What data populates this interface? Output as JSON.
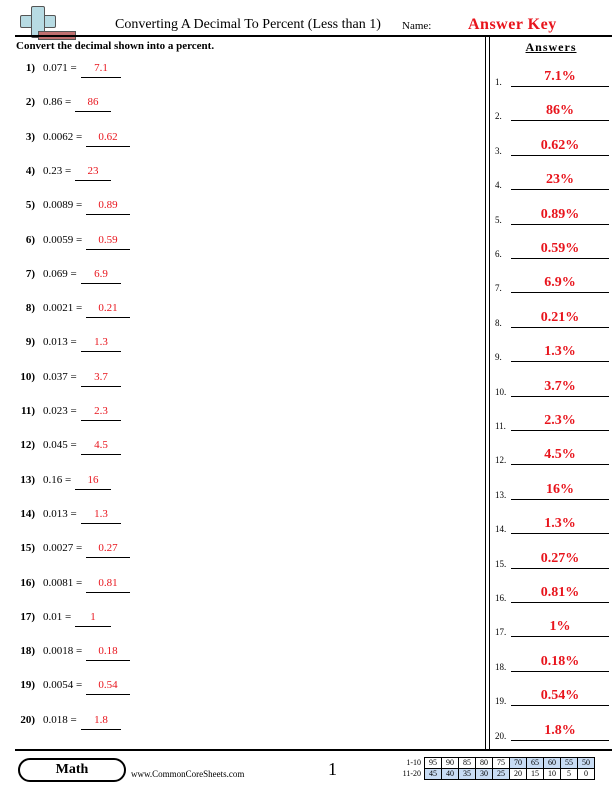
{
  "header": {
    "title": "Converting A Decimal To Percent (Less than 1)",
    "name_label": "Name:",
    "name_value": "Answer Key",
    "logo_icon": "plus-logo-icon"
  },
  "instructions": "Convert the decimal shown into a percent.",
  "answers_heading": "Answers",
  "problems": [
    {
      "num": "1)",
      "question": "0.071 =",
      "answer": "7.1"
    },
    {
      "num": "2)",
      "question": "0.86 =",
      "answer": "86"
    },
    {
      "num": "3)",
      "question": "0.0062 =",
      "answer": "0.62"
    },
    {
      "num": "4)",
      "question": "0.23 =",
      "answer": "23"
    },
    {
      "num": "5)",
      "question": "0.0089 =",
      "answer": "0.89"
    },
    {
      "num": "6)",
      "question": "0.0059 =",
      "answer": "0.59"
    },
    {
      "num": "7)",
      "question": "0.069 =",
      "answer": "6.9"
    },
    {
      "num": "8)",
      "question": "0.0021 =",
      "answer": "0.21"
    },
    {
      "num": "9)",
      "question": "0.013 =",
      "answer": "1.3"
    },
    {
      "num": "10)",
      "question": "0.037 =",
      "answer": "3.7"
    },
    {
      "num": "11)",
      "question": "0.023 =",
      "answer": "2.3"
    },
    {
      "num": "12)",
      "question": "0.045 =",
      "answer": "4.5"
    },
    {
      "num": "13)",
      "question": "0.16 =",
      "answer": "16"
    },
    {
      "num": "14)",
      "question": "0.013 =",
      "answer": "1.3"
    },
    {
      "num": "15)",
      "question": "0.0027 =",
      "answer": "0.27"
    },
    {
      "num": "16)",
      "question": "0.0081 =",
      "answer": "0.81"
    },
    {
      "num": "17)",
      "question": "0.01 =",
      "answer": "1"
    },
    {
      "num": "18)",
      "question": "0.0018 =",
      "answer": "0.18"
    },
    {
      "num": "19)",
      "question": "0.0054 =",
      "answer": "0.54"
    },
    {
      "num": "20)",
      "question": "0.018 =",
      "answer": "1.8"
    }
  ],
  "answer_key": [
    {
      "num": "1.",
      "value": "7.1%"
    },
    {
      "num": "2.",
      "value": "86%"
    },
    {
      "num": "3.",
      "value": "0.62%"
    },
    {
      "num": "4.",
      "value": "23%"
    },
    {
      "num": "5.",
      "value": "0.89%"
    },
    {
      "num": "6.",
      "value": "0.59%"
    },
    {
      "num": "7.",
      "value": "6.9%"
    },
    {
      "num": "8.",
      "value": "0.21%"
    },
    {
      "num": "9.",
      "value": "1.3%"
    },
    {
      "num": "10.",
      "value": "3.7%"
    },
    {
      "num": "11.",
      "value": "2.3%"
    },
    {
      "num": "12.",
      "value": "4.5%"
    },
    {
      "num": "13.",
      "value": "16%"
    },
    {
      "num": "14.",
      "value": "1.3%"
    },
    {
      "num": "15.",
      "value": "0.27%"
    },
    {
      "num": "16.",
      "value": "0.81%"
    },
    {
      "num": "17.",
      "value": "1%"
    },
    {
      "num": "18.",
      "value": "0.18%"
    },
    {
      "num": "19.",
      "value": "0.54%"
    },
    {
      "num": "20.",
      "value": "1.8%"
    }
  ],
  "footer": {
    "badge": "Math",
    "site": "www.CommonCoreSheets.com",
    "page": "1",
    "score_table": {
      "rows": [
        {
          "label": "1-10",
          "values": [
            "95",
            "90",
            "85",
            "80",
            "75",
            "70",
            "65",
            "60",
            "55",
            "50"
          ],
          "shaded": [
            false,
            false,
            false,
            false,
            false,
            true,
            true,
            true,
            true,
            true
          ]
        },
        {
          "label": "11-20",
          "values": [
            "45",
            "40",
            "35",
            "30",
            "25",
            "20",
            "15",
            "10",
            "5",
            "0"
          ],
          "shaded": [
            true,
            true,
            true,
            true,
            true,
            false,
            false,
            false,
            false,
            false
          ]
        }
      ],
      "shade_color": "#c8dcf4"
    }
  },
  "colors": {
    "answer_red": "#e8141c"
  }
}
